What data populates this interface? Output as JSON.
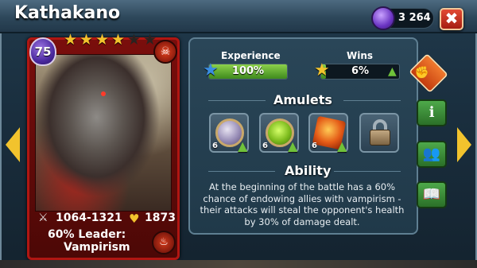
{
  "window": {
    "title": "Kathakano",
    "currency_value": "3 264",
    "close_label": "✖"
  },
  "card": {
    "level": "75",
    "stars_on": 4,
    "stars_total": 6,
    "attack": "1064-1321",
    "health": "1873",
    "leader_line1": "60%  Leader:",
    "leader_line2": "Vampirism"
  },
  "stats": {
    "experience_label": "Experience",
    "experience_value": "100%",
    "experience_fill": 1.0,
    "wins_label": "Wins",
    "wins_value": "6%",
    "wins_fill": 0.06
  },
  "amulets": {
    "title": "Amulets",
    "items": [
      {
        "level": "6"
      },
      {
        "level": "6"
      },
      {
        "level": "6"
      }
    ]
  },
  "ability": {
    "title": "Ability",
    "text": "At the beginning of the battle has a 60% chance of endowing allies with vampirism - their attacks will steal the opponent's health by 30% of damage dealt."
  },
  "colors": {
    "accent": "#f2c32d",
    "bar_green": "#6fc23a",
    "close_red": "#c22a18",
    "card_red": "#b01612"
  }
}
